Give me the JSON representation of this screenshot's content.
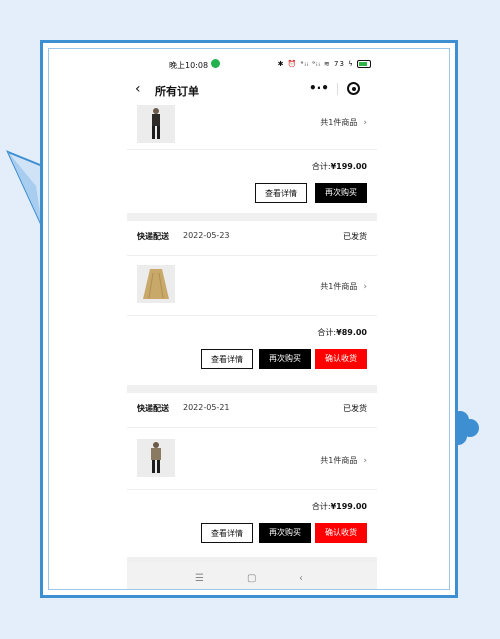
{
  "status_bar": {
    "time": "晚上10:08",
    "icons": "✱ ⏰ ᵊᵢᵢ ᵊᵢᵢ ≋ 73 ϟ"
  },
  "nav": {
    "title": "所有订单",
    "more": "•·•"
  },
  "orders": [
    {
      "count": "共1件商品",
      "total_label": "合计:",
      "total": "¥199.00",
      "buttons": [
        "查看详情",
        "再次购买"
      ]
    },
    {
      "ship": "快递配送",
      "date": "2022-05-23",
      "status": "已发货",
      "count": "共1件商品",
      "total_label": "合计:",
      "total": "¥89.00",
      "buttons": [
        "查看详情",
        "再次购买",
        "确认收货"
      ]
    },
    {
      "ship": "快递配送",
      "date": "2022-05-21",
      "status": "已发货",
      "count": "共1件商品",
      "total_label": "合计:",
      "total": "¥199.00",
      "buttons": [
        "查看详情",
        "再次购买",
        "确认收货"
      ]
    }
  ],
  "system_nav": {
    "menu": "☰",
    "home": "▢",
    "back": "‹"
  },
  "colors": {
    "frame": "#3e8ed2",
    "confirm": "#ff0000",
    "primary": "#000000"
  }
}
